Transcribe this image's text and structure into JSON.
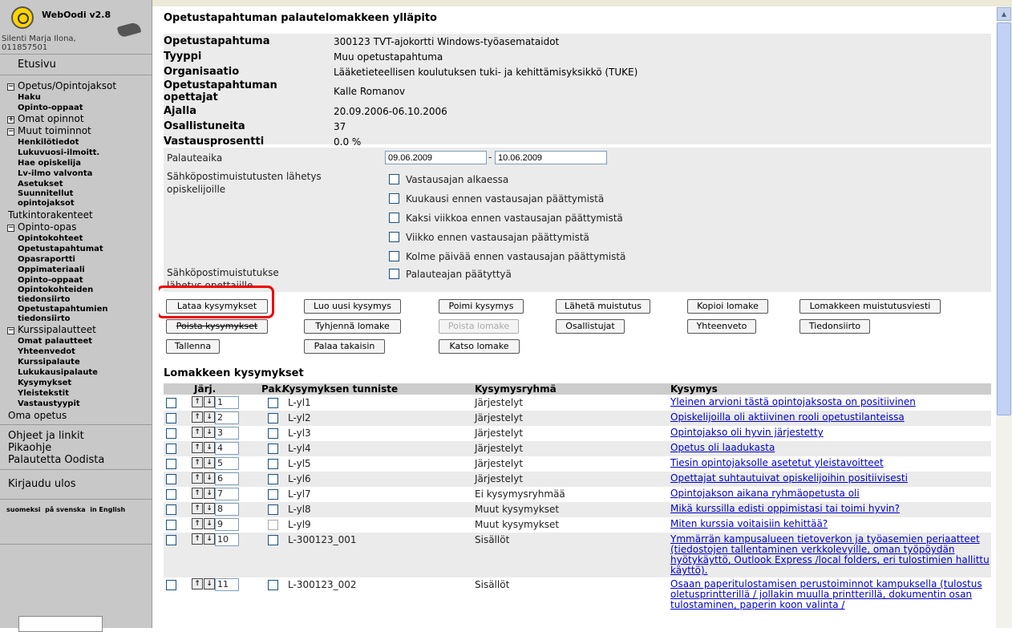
{
  "app": {
    "name": "WebOodi v2.8",
    "user": "Silenti Marja Ilona,\n011857501"
  },
  "nav": {
    "home": "Etusivu",
    "opetus": {
      "label": "Opetus/Opintojaksot",
      "toggle": "−",
      "items": [
        "Haku",
        "Opinto-oppaat"
      ]
    },
    "omat": {
      "label": "Omat opinnot",
      "toggle": "+"
    },
    "muut": {
      "label": "Muut toiminnot",
      "toggle": "−",
      "items": [
        "Henkilötiedot",
        "Lukuvuosi-ilmoitt.",
        "Hae opiskelija",
        "Lv-ilmo valvonta",
        "Asetukset",
        "Suunnitellut opintojaksot"
      ]
    },
    "tutkinto": "Tutkintorakenteet",
    "opas": {
      "label": "Opinto-opas",
      "toggle": "−",
      "items": [
        "Opintokohteet",
        "Opetustapahtumat",
        "Opasraportti",
        "Oppimateriaali",
        "Opinto-oppaat",
        "Opintokohteiden tiedonsiirto",
        "Opetustapahtumien tiedonsiirto"
      ]
    },
    "kurssi": {
      "label": "Kurssipalautteet",
      "toggle": "−",
      "items": [
        "Omat palautteet",
        "Yhteenvedot",
        "Kurssipalaute",
        "Lukukausipalaute",
        "Kysymykset",
        "Yleistekstit",
        "Vastaustyypit"
      ]
    },
    "omaopetus": "Oma opetus",
    "help": [
      "Ohjeet ja linkit",
      "Pikaohje",
      "Palautetta Oodista"
    ],
    "logout": "Kirjaudu ulos",
    "langs": [
      "suomeksi",
      "på svenska",
      "in English"
    ]
  },
  "page": {
    "title": "Opetustapahtuman palautelomakkeen ylläpito"
  },
  "info": [
    {
      "k": "Opetustapahtuma",
      "v": "300123 TVT-ajokortti Windows-työasemataidot"
    },
    {
      "k": "Tyyppi",
      "v": "Muu opetustapahtuma"
    },
    {
      "k": "Organisaatio",
      "v": "Lääketieteellisen koulutuksen tuki- ja kehittämisyksikkö (TUKE)"
    },
    {
      "k": "Opetustapahtuman opettajat",
      "v": "Kalle Romanov"
    },
    {
      "k": "Ajalla",
      "v": "20.09.2006-06.10.2006"
    },
    {
      "k": "Osallistuneita",
      "v": "37"
    },
    {
      "k": "Vastausprosentti",
      "v": "0.0 %"
    }
  ],
  "form": {
    "period_label": "Palauteaika",
    "start": "09.06.2009",
    "end": "10.06.2009",
    "dash": "-",
    "student_reminder_label": "Sähköpostimuistutusten lähetys opiskelijoille",
    "student_options": [
      "Vastausajan alkaessa",
      "Kuukausi ennen vastausajan päättymistä",
      "Kaksi viikkoa ennen vastausajan päättymistä",
      "Viikko ennen vastausajan päättymistä",
      "Kolme päivää ennen vastausajan päättymistä"
    ],
    "teacher_reminder_label": "Sähköpostimuistutuksen lähetys opettajille",
    "teacher_option": "Palauteajan päätyttyä"
  },
  "buttons": {
    "row1": [
      "Lataa kysymykset",
      "Luo uusi kysymys",
      "Poimi kysymys",
      "Lähetä muistutus",
      "Kopioi lomake",
      "Lomakkeen muistutusviesti"
    ],
    "row2": [
      "Poista kysymykset",
      "Tyhjennä lomake",
      "Poista lomake",
      "Osallistujat",
      "Yhteenveto",
      "Tiedonsiirto"
    ],
    "row3": [
      "Tallenna",
      "Palaa takaisin",
      "Katso lomake"
    ]
  },
  "questions": {
    "heading": "Lomakkeen kysymykset",
    "columns": {
      "order": "Järj.",
      "mandatory": "Pak.",
      "id": "Kysymyksen tunniste",
      "group": "Kysymysryhmä",
      "question": "Kysymys"
    },
    "rows": [
      {
        "order": "1",
        "id": "L-yl1",
        "group": "Järjestelyt",
        "q": "Yleinen arvioni tästä opintojaksosta on positiivinen"
      },
      {
        "order": "2",
        "id": "L-yl2",
        "group": "Järjestelyt",
        "q": "Opiskelijoilla oli aktiivinen rooli opetustilanteissa"
      },
      {
        "order": "3",
        "id": "L-yl3",
        "group": "Järjestelyt",
        "q": "Opintojakso oli hyvin järjestetty"
      },
      {
        "order": "4",
        "id": "L-yl4",
        "group": "Järjestelyt",
        "q": "Opetus oli laadukasta"
      },
      {
        "order": "5",
        "id": "L-yl5",
        "group": "Järjestelyt",
        "q": "Tiesin opintojaksolle asetetut yleistavoitteet"
      },
      {
        "order": "6",
        "id": "L-yl6",
        "group": "Järjestelyt",
        "q": "Opettajat suhtautuivat opiskelijoihin positiivisesti"
      },
      {
        "order": "7",
        "id": "L-yl7",
        "group": "Ei kysymysryhmää",
        "q": "Opintojakson aikana ryhmäopetusta oli"
      },
      {
        "order": "8",
        "id": "L-yl8",
        "group": "Muut kysymykset",
        "q": "Mikä kurssilla edisti oppimistasi tai toimi hyvin?"
      },
      {
        "order": "9",
        "id": "L-yl9",
        "group": "Muut kysymykset",
        "q": "Miten kurssia voitaisiin kehittää?"
      },
      {
        "order": "10",
        "id": "L-300123_001",
        "group": "Sisällöt",
        "q": "Ymmärrän kampusalueen tietoverkon ja työasemien periaatteet (tiedostojen tallentaminen verkkolevyille, oman työpöydän hyötykäyttö, Outlook Express /local folders, eri tulostimien hallittu käyttö)."
      },
      {
        "order": "11",
        "id": "L-300123_002",
        "group": "Sisällöt",
        "q": "Osaan paperitulostamisen perustoiminnot kampuksella (tulostus oletusprintterillä / jollakin muulla printterillä, dokumentin osan tulostaminen, paperin koon valinta /"
      }
    ]
  }
}
